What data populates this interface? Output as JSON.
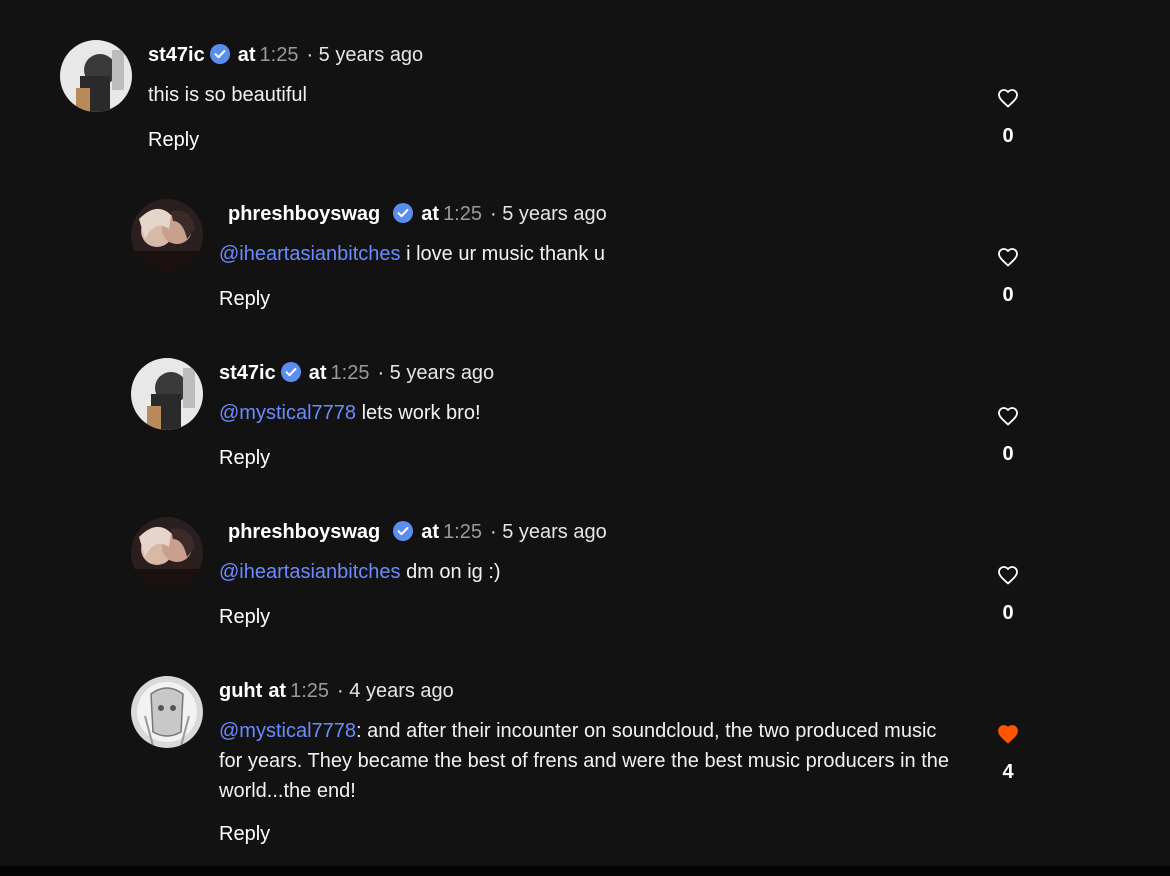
{
  "comments": [
    {
      "username": "st47ic",
      "verified": true,
      "at_word": "at",
      "timestamp": "1:25",
      "ago": "· 5 years ago",
      "mention": "",
      "text": "this is so beautiful",
      "reply_label": "Reply",
      "like_count": "0",
      "liked": false
    },
    {
      "username": "phreshboyswag",
      "verified": true,
      "at_word": "at",
      "timestamp": "1:25",
      "ago": "· 5 years ago",
      "mention": "@iheartasianbitches",
      "text": " i love ur music thank u",
      "reply_label": "Reply",
      "like_count": "0",
      "liked": false
    },
    {
      "username": "st47ic",
      "verified": true,
      "at_word": "at",
      "timestamp": "1:25",
      "ago": "· 5 years ago",
      "mention": "@mystical7778",
      "text": " lets work bro!",
      "reply_label": "Reply",
      "like_count": "0",
      "liked": false
    },
    {
      "username": "phreshboyswag",
      "verified": true,
      "at_word": "at",
      "timestamp": "1:25",
      "ago": "· 5 years ago",
      "mention": "@iheartasianbitches",
      "text": " dm on ig :)",
      "reply_label": "Reply",
      "like_count": "0",
      "liked": false
    },
    {
      "username": "guht",
      "verified": false,
      "at_word": "at",
      "timestamp": "1:25",
      "ago": "· 4 years ago",
      "mention": "@mystical7778",
      "text": ": and after their incounter on soundcloud, the two produced music for years. They became the best of frens and were the best music producers in the world...the end!",
      "reply_label": "Reply",
      "like_count": "4",
      "liked": true
    }
  ],
  "icons": {
    "verified": "verified-check-icon",
    "like": "heart-icon"
  },
  "colors": {
    "background": "#121212",
    "mention": "#6b8cff",
    "verified": "#5b8def",
    "liked_heart": "#ff5500",
    "timestamp": "#9a9a9a"
  }
}
